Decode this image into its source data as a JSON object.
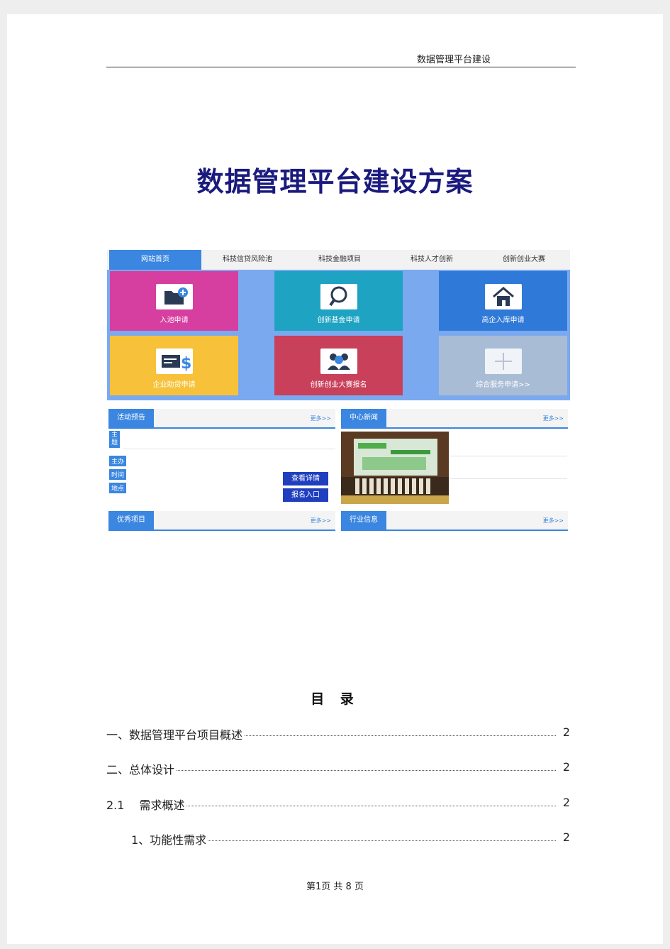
{
  "header": {
    "running_title": "数据管理平台建设"
  },
  "document": {
    "title": "数据管理平台建设方案"
  },
  "screenshot": {
    "nav_tabs": [
      "网站首页",
      "科技信贷风险池",
      "科技金融项目",
      "科技人才创新",
      "创新创业大赛"
    ],
    "tiles": [
      {
        "label": "入池申请",
        "color": "#d63f9f",
        "icon": "folder-plus-icon"
      },
      {
        "label": "创新基金申请",
        "color": "#1fa3c2",
        "icon": "magnifier-icon"
      },
      {
        "label": "高企入库申请",
        "color": "#2f7ad8",
        "icon": "house-icon"
      },
      {
        "label": "企业助贷申请",
        "color": "#f7c23a",
        "icon": "dollar-card-icon"
      },
      {
        "label": "创新创业大赛报名",
        "color": "#c8405a",
        "icon": "people-group-icon"
      },
      {
        "label": "综合服务申请>>",
        "color": "#a9bcd6",
        "icon": "plus-icon"
      }
    ],
    "boxes": {
      "activity": {
        "tab": "活动预告",
        "more": "更多>>"
      },
      "news": {
        "tab": "中心新闻",
        "more": "更多>>"
      },
      "projects": {
        "tab": "优秀项目",
        "more": "更多>>"
      },
      "industry": {
        "tab": "行业信息",
        "more": "更多>>"
      }
    },
    "activity_tags": [
      "主\n题",
      "主办",
      "时间",
      "地点"
    ],
    "activity_buttons": [
      "查看详情",
      "报名入口"
    ],
    "accent_color": "#3a86e0"
  },
  "toc": {
    "title": "目 录",
    "entries": [
      {
        "label": "一、数据管理平台项目概述",
        "page": "2"
      },
      {
        "label": "二、总体设计",
        "page": "2"
      },
      {
        "label": "2.1　 需求概述",
        "page": "2"
      },
      {
        "label": "1、功能性需求",
        "page": "2"
      }
    ]
  },
  "footer": {
    "page_info": "第1页 共 8 页"
  }
}
